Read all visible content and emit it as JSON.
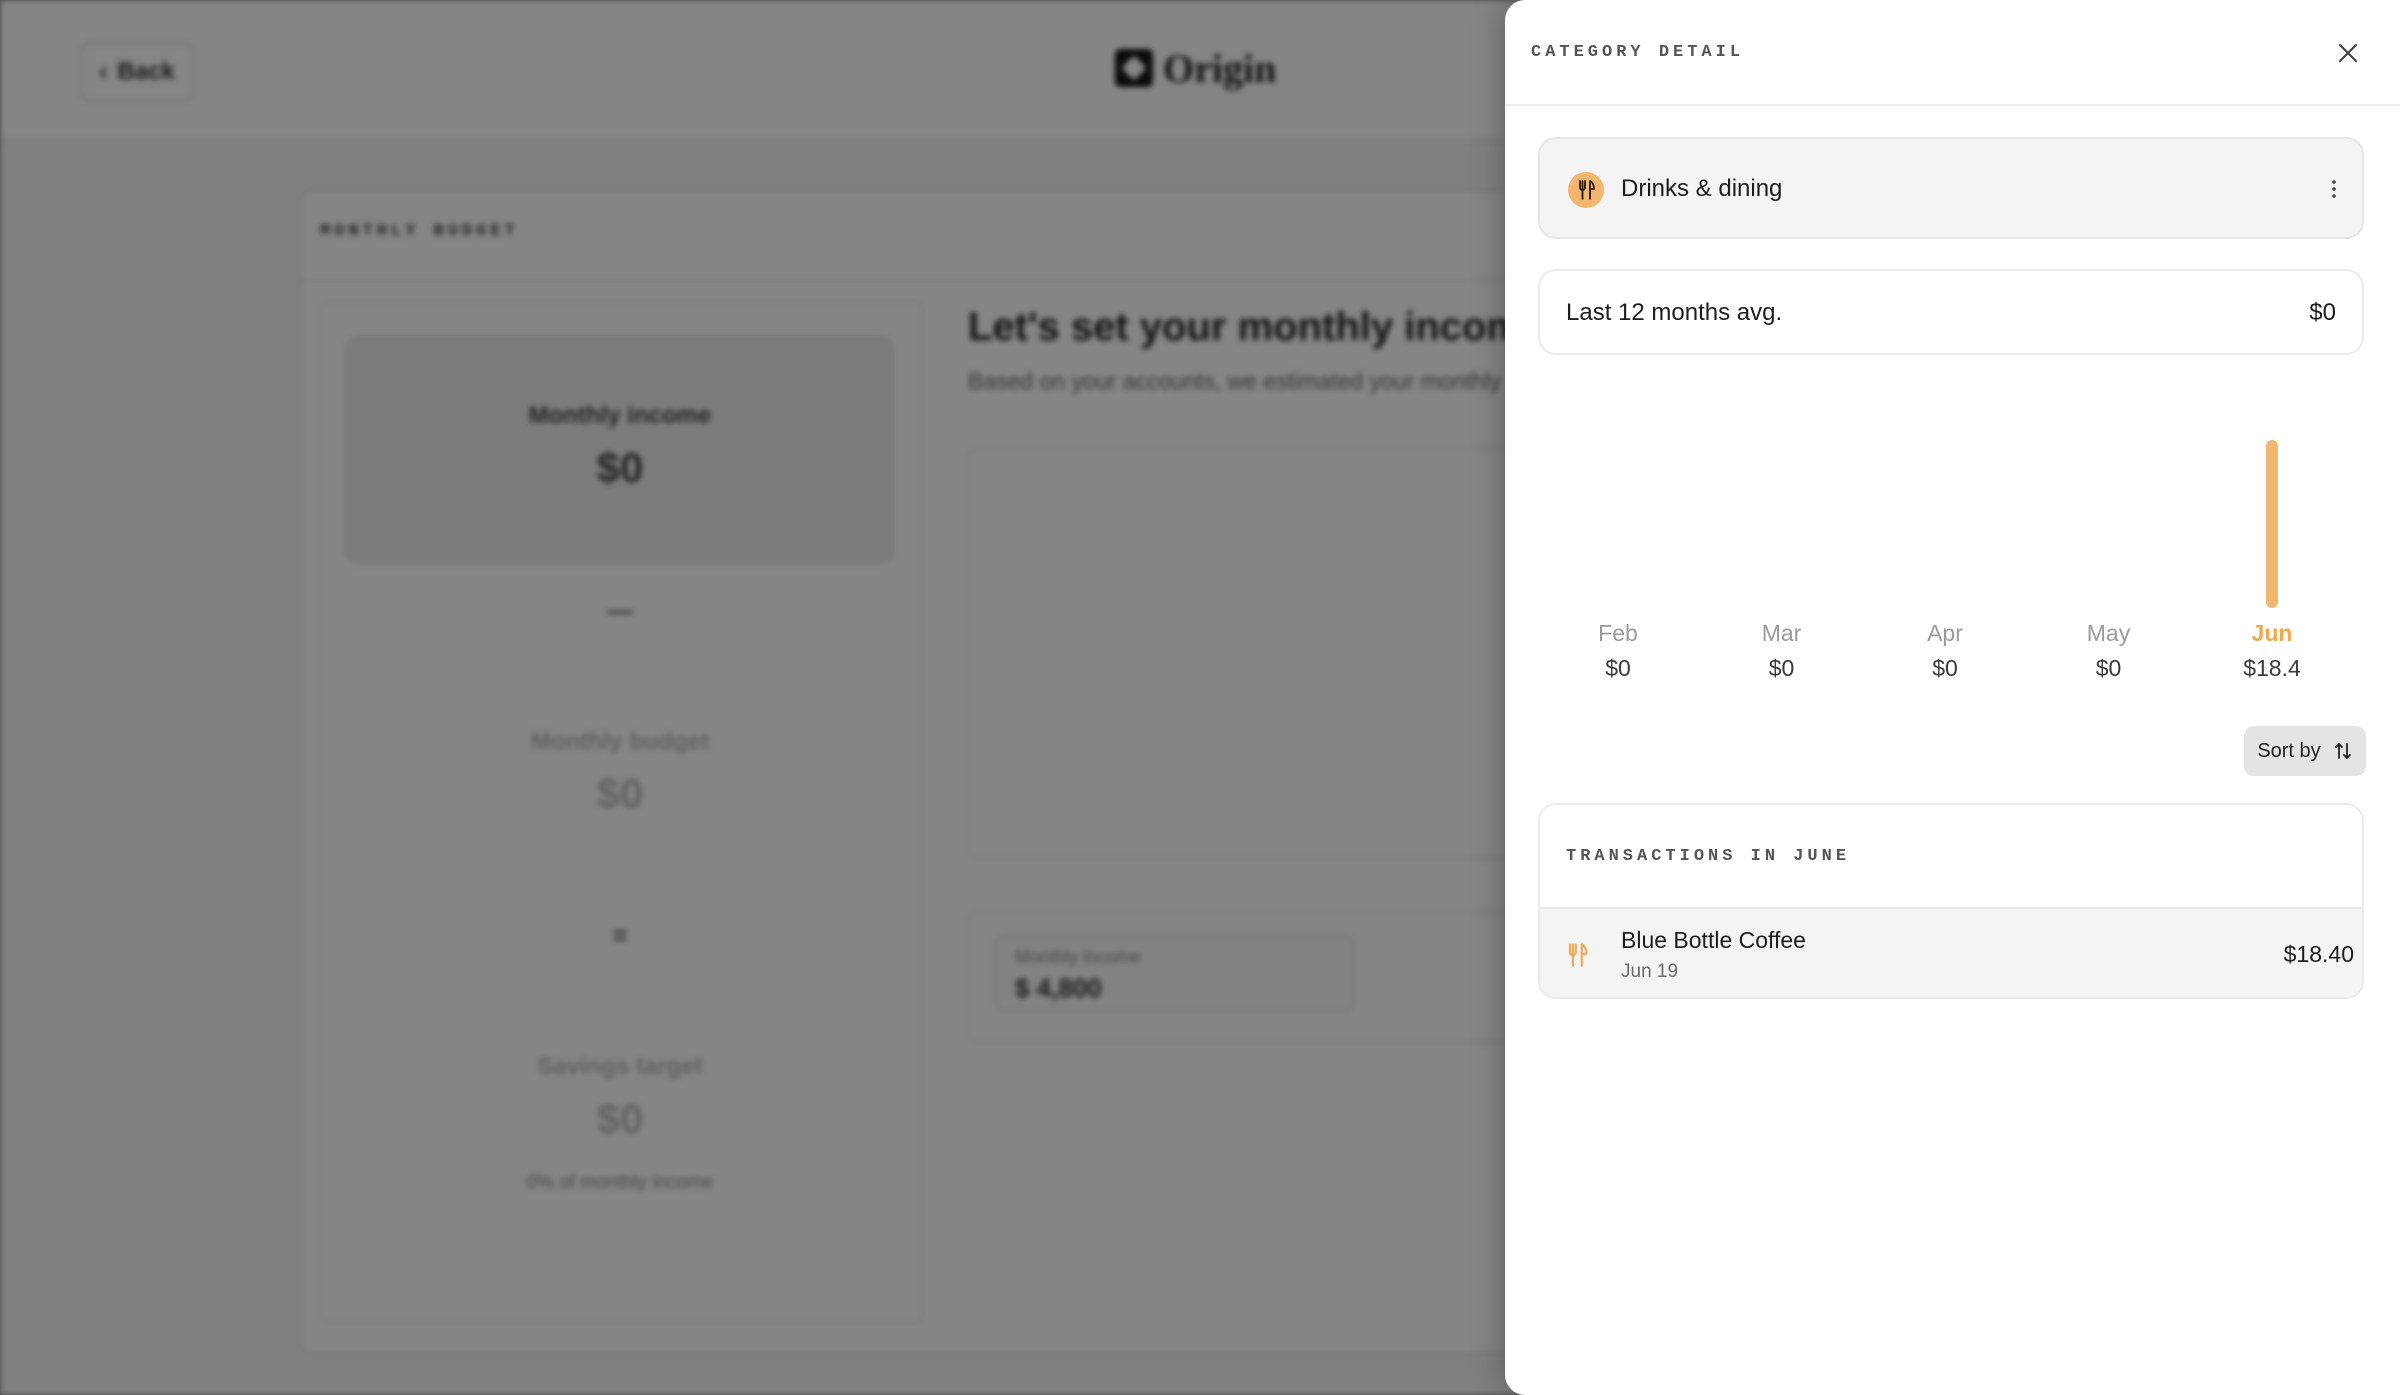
{
  "background": {
    "back_label": "Back",
    "logo_text": "Origin",
    "card_title": "MONTHLY BUDGET",
    "stats": [
      {
        "label": "Monthly income",
        "value": "$0"
      },
      {
        "label": "Monthly budget",
        "value": "$0"
      },
      {
        "label": "Savings target",
        "value": "$0"
      }
    ],
    "op_minus": "—",
    "op_equals": "=",
    "savings_note": "0% of monthly income",
    "heading": "Let's set your monthly income.",
    "subheading": "Based on your accounts, we estimated your monthly income",
    "input_label": "Monthly income",
    "input_value": "$ 4,800"
  },
  "drawer": {
    "title": "CATEGORY DETAIL",
    "category": {
      "name": "Drinks & dining",
      "icon": "fork-knife-icon",
      "color": "#f3b670"
    },
    "average": {
      "label": "Last 12 months avg.",
      "value": "$0"
    },
    "sort_label": "Sort by",
    "transactions_title": "TRANSACTIONS IN JUNE",
    "transactions": [
      {
        "name": "Blue Bottle Coffee",
        "date": "Jun 19",
        "amount": "$18.40",
        "icon": "fork-knife-icon"
      }
    ]
  },
  "chart_data": {
    "type": "bar",
    "categories": [
      "Feb",
      "Mar",
      "Apr",
      "May",
      "Jun"
    ],
    "values": [
      0,
      0,
      0,
      0,
      18.4
    ],
    "value_labels": [
      "$0",
      "$0",
      "$0",
      "$0",
      "$18.4"
    ],
    "highlight": "Jun",
    "bar_color": "#f3b670",
    "ylim": [
      0,
      18.4
    ]
  }
}
